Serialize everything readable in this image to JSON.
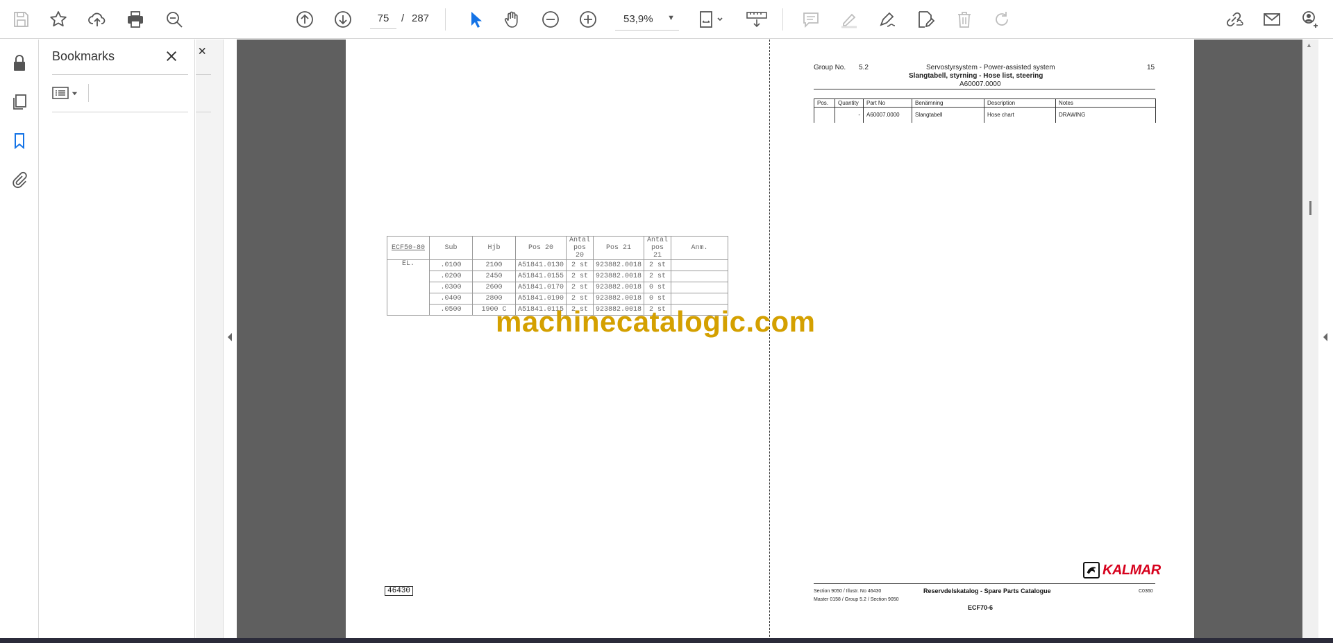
{
  "toolbar": {
    "current_page": "75",
    "page_separator": "/",
    "total_pages": "287",
    "zoom": "53,9%"
  },
  "bookmarks_panel": {
    "title": "Bookmarks"
  },
  "left_page": {
    "table": {
      "headers": [
        "ECF50-80",
        "Sub",
        "Hjb",
        "Pos 20",
        "Antal pos 20",
        "Pos 21",
        "Antal pos 21",
        "Anm."
      ],
      "model": "EL.",
      "rows": [
        [
          ".0100",
          "2100",
          "A51841.0130",
          "2 st",
          "923882.0018",
          "2 st",
          ""
        ],
        [
          ".0200",
          "2450",
          "A51841.0155",
          "2 st",
          "923882.0018",
          "2 st",
          ""
        ],
        [
          ".0300",
          "2600",
          "A51841.0170",
          "2 st",
          "923882.0018",
          "0 st",
          ""
        ],
        [
          ".0400",
          "2800",
          "A51841.0190",
          "2 st",
          "923882.0018",
          "0 st",
          ""
        ],
        [
          ".0500",
          "1900 C",
          "A51841.0115",
          "2 st",
          "923882.0018",
          "2 st",
          ""
        ]
      ]
    },
    "illustration_no": "46430"
  },
  "watermark": "machinecatalogic.com",
  "right_page": {
    "group_label": "Group No.",
    "group_no": "5.2",
    "system": "Servostyrsystem - Power-assisted system",
    "page_no": "15",
    "title": "Slangtabell, styrning - Hose list, steering",
    "part_ref": "A60007.0000",
    "parts_headers": [
      "Pos.",
      "Quantity",
      "Part No",
      "Benämning",
      "Description",
      "Notes"
    ],
    "parts_rows": [
      [
        "",
        "-",
        "A60007.0000",
        "Slangtabell",
        "Hose chart",
        "DRAWING"
      ]
    ],
    "brand": "KALMAR",
    "footer_line1": "Section  9050 / Illustr. No   46430",
    "footer_line2": "Master 0158  / Group 5.2 / Section   9050",
    "catalogue": "Reservdelskatalog - Spare Parts Catalogue",
    "code": "C0360",
    "model": "ECF70-6"
  },
  "colors": {
    "accent_blue": "#1473e6",
    "watermark": "#d4a000",
    "kalmar_red": "#d6001c"
  }
}
